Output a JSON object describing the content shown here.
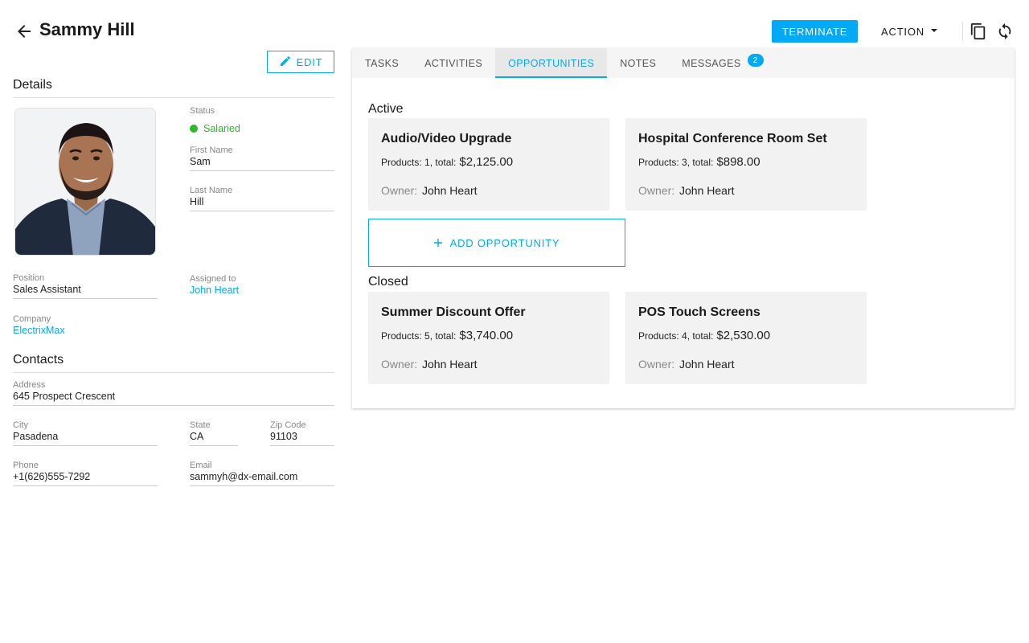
{
  "header": {
    "title": "Sammy Hill",
    "terminate_label": "TERMINATE",
    "action_label": "ACTION"
  },
  "colors": {
    "accent": "#03a9f4",
    "status_green": "#2eb82e",
    "card_bg": "#f2f2f2"
  },
  "icons": [
    "arrow-left-icon",
    "pencil-icon",
    "caret-down-icon",
    "copy-icon",
    "refresh-icon",
    "plus-icon"
  ],
  "details": {
    "edit_label": "EDIT",
    "section_title": "Details",
    "status_label": "Status",
    "status_value": "Salaried",
    "first_name_label": "First Name",
    "first_name": "Sam",
    "last_name_label": "Last Name",
    "last_name": "Hill",
    "position_label": "Position",
    "position": "Sales Assistant",
    "assigned_label": "Assigned to",
    "assigned": "John Heart",
    "company_label": "Company",
    "company": "ElectrixMax"
  },
  "contacts": {
    "section_title": "Contacts",
    "address_label": "Address",
    "address": "645 Prospect Crescent",
    "city_label": "City",
    "city": "Pasadena",
    "state_label": "State",
    "state": "CA",
    "zip_label": "Zip Code",
    "zip": "91103",
    "phone_label": "Phone",
    "phone": "+1(626)555-7292",
    "email_label": "Email",
    "email": "sammyh@dx-email.com"
  },
  "tabs": [
    {
      "label": "TASKS"
    },
    {
      "label": "ACTIVITIES"
    },
    {
      "label": "OPPORTUNITIES",
      "active": true
    },
    {
      "label": "NOTES"
    },
    {
      "label": "MESSAGES",
      "badge": "2"
    }
  ],
  "opportunities": {
    "active_title": "Active",
    "closed_title": "Closed",
    "add_label": "ADD OPPORTUNITY",
    "owner_label": "Owner:",
    "active": [
      {
        "name": "Audio/Video Upgrade",
        "products": "Products: 1, total:",
        "total": "$2,125.00",
        "owner": "John Heart"
      },
      {
        "name": "Hospital Conference Room Set",
        "products": "Products: 3, total:",
        "total": "$898.00",
        "owner": "John Heart"
      }
    ],
    "closed": [
      {
        "name": "Summer Discount Offer",
        "products": "Products: 5, total:",
        "total": "$3,740.00",
        "owner": "John Heart"
      },
      {
        "name": "POS Touch Screens",
        "products": "Products: 4, total:",
        "total": "$2,530.00",
        "owner": "John Heart"
      }
    ]
  }
}
